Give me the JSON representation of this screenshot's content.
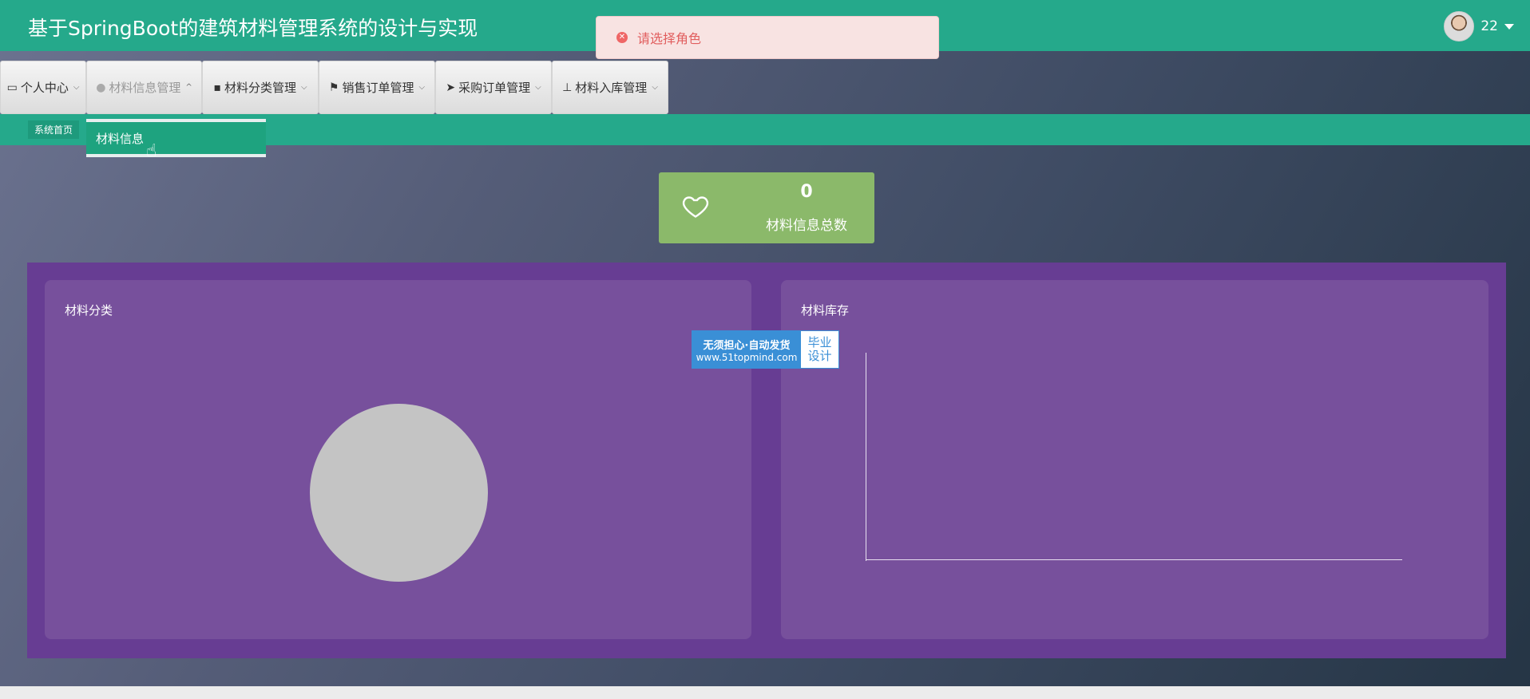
{
  "app": {
    "title": "基于SpringBoot的建筑材料管理系统的设计与实现"
  },
  "user": {
    "name": "22"
  },
  "toast": {
    "message": "请选择角色"
  },
  "nav": {
    "items": [
      {
        "label": "个人中心",
        "icon": "calendar-icon"
      },
      {
        "label": "材料信息管理",
        "icon": "location-pin-icon"
      },
      {
        "label": "材料分类管理",
        "icon": "chat-icon"
      },
      {
        "label": "销售订单管理",
        "icon": "flag-icon"
      },
      {
        "label": "采购订单管理",
        "icon": "send-icon"
      },
      {
        "label": "材料入库管理",
        "icon": "stamp-icon"
      }
    ]
  },
  "breadcrumb": {
    "home": "系统首页"
  },
  "dropdown": {
    "item": "材料信息"
  },
  "stat": {
    "value": "0",
    "label": "材料信息总数",
    "color": "#8bb96a"
  },
  "panels": {
    "left_title": "材料分类",
    "right_title": "材料库存"
  },
  "badge": {
    "line1": "无须担心·自动发货",
    "line2": "www.51topmind.com",
    "right1": "毕业",
    "right2": "设计"
  },
  "colors": {
    "primary": "#25a98b",
    "panel_bg": "#673d93",
    "panel_card": "#77509c"
  }
}
